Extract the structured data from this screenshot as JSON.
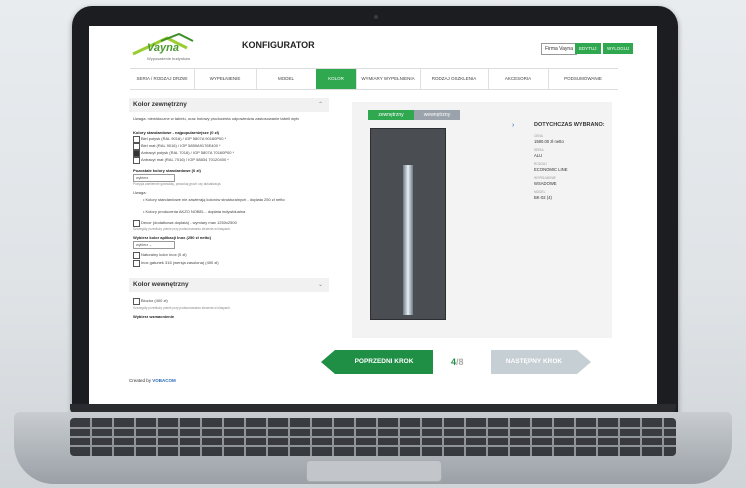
{
  "header": {
    "logo_text": "Vayna",
    "logo_tagline": "Wyposażenie budynków",
    "title": "KONFIGURATOR",
    "firm_label": "Firma Vayna",
    "edit_label": "EDYTUJ",
    "logout_label": "WYLOGUJ"
  },
  "nav": {
    "items": [
      {
        "label": "SERIA / RODZAJ DRZWI"
      },
      {
        "label": "WYPEŁNIENIE"
      },
      {
        "label": "MODEL"
      },
      {
        "label": "KOLOR"
      },
      {
        "label": "WYMIARY WYPEŁNIENIA"
      },
      {
        "label": "RODZAJ OSZKLENIA"
      },
      {
        "label": "AKCESORIA"
      },
      {
        "label": "PODSUMOWANIE"
      }
    ],
    "active_index": 3
  },
  "exterior": {
    "heading": "Kolor zewnętrzny",
    "intro": "Uwaga: niewidoczne w tabelu, oraz hotowy producenta odpowiedzia zastosowanie tabeli wytv",
    "standard_heading": "Kolory standardowe - najpopularniejsze (0 zł)",
    "options": [
      {
        "label": "Biel połysk (RAL 9016) / IGP 5807A 90160P00 *",
        "checked": false
      },
      {
        "label": "Biel mat (RAL 9016) / IGP 5859A9176E400 *",
        "checked": false
      },
      {
        "label": "Antracyt połysk (RAL 7016) / IGP 5807A 70160P00 *",
        "checked": true
      },
      {
        "label": "Antracyt mat (RAL 7016) / IGP 58834 70120400 *",
        "checked": false
      }
    ],
    "other_heading": "Pozostałe kolory standardowe (0 zł)",
    "other_select": "wybierz",
    "other_note": "Pozycja zamiennie gotowiołę, poszukaj gruch czy aktualizacja.",
    "notes_label": "Uwaga:",
    "bullets": [
      "Kolory standardowe nie zawierają kolorów strukturalnych - dopłata 250 zł netto",
      "Kolory producenta AKZO NOBEL - dopłata indywidualna"
    ],
    "decor_label": "Decor (dodatkowa dopłata) - wymiary max 1250x2500",
    "decor_note": "Szczegóły przedłuży potnie przy podsumowaniu zlecenia w klasyach.",
    "application_heading": "Wybierz kolor aplikacji Inox (250 zł netto)",
    "application_select": "wybierz",
    "inox_options": [
      {
        "label": "Naturalny kolor Inox (0 zł)",
        "checked": false
      },
      {
        "label": "Inox gatunek 316 (wersja zasolona) (400 zł)",
        "checked": false
      }
    ]
  },
  "interior": {
    "heading": "Kolor wewnętrzny",
    "option": "Biozior (400 zł)",
    "option_note": "Szczegóły przedłuży potnie przy podsumowaniu zlecenia w klasyach.",
    "extra_heading": "Wybierz wzmacnienie"
  },
  "footer": {
    "created_prefix": "Created by",
    "created_brand": "VOBACOM"
  },
  "preview": {
    "tab_exterior": "zewnętrzny",
    "tab_interior": "wewnętrzny",
    "summary_heading": "DOTYCHCZAS WYBRANO:",
    "fields": [
      {
        "label": "CENA",
        "value": "1590.00 zł netto"
      },
      {
        "label": "SERIA",
        "value": "ALU"
      },
      {
        "label": "RODZAJ",
        "value": "ECONOMIC LINE"
      },
      {
        "label": "WYPEŁNIENIE",
        "value": "WSADOWE"
      },
      {
        "label": "MODEL",
        "value": "BK-02 (4)"
      }
    ]
  },
  "stepper": {
    "prev_label": "POPRZEDNI KROK",
    "current": "4",
    "total": "/8",
    "next_label": "NASTĘPNY KROK"
  },
  "colors": {
    "accent_green": "#2fa84f",
    "tab_exterior": "#2fa84f",
    "tab_interior": "#9aa3ab",
    "door": "#4a4d52"
  }
}
